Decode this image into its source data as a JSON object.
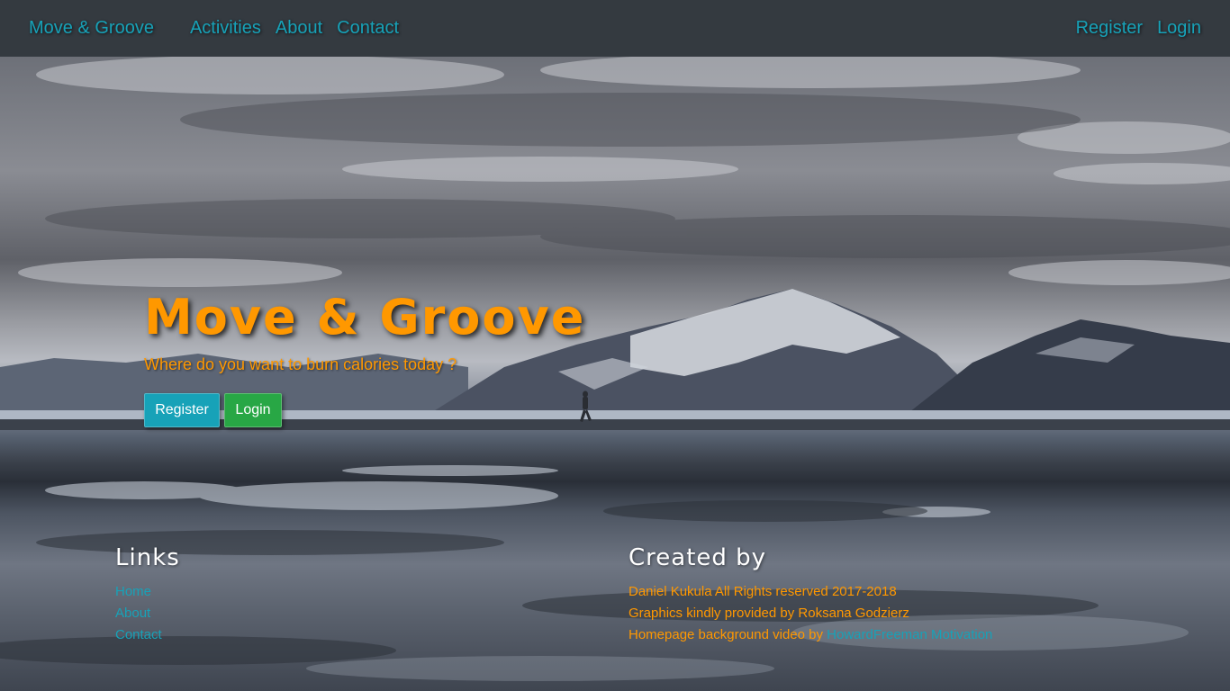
{
  "navbar": {
    "brand": "Move & Groove",
    "left_items": [
      "Activities",
      "About",
      "Contact"
    ],
    "right_items": [
      "Register",
      "Login"
    ]
  },
  "hero": {
    "title": "Move & Groove",
    "subtitle": "Where do you want to burn calories today ?",
    "register_label": "Register",
    "login_label": "Login"
  },
  "footer": {
    "links_heading": "Links",
    "links": [
      "Home",
      "About",
      "Contact"
    ],
    "created_heading": "Created by",
    "credit_lines": [
      "Daniel Kukula All Rights reserved 2017-2018",
      "Graphics kindly provided by Roksana Godzierz"
    ],
    "video_credit_prefix": "Homepage background video by ",
    "video_credit_link": "HowardFreeman Motivation"
  },
  "colors": {
    "navbar_bg": "#343a40",
    "link_teal": "#17a2b8",
    "accent_orange": "#ff9800",
    "login_green": "#28a745"
  }
}
